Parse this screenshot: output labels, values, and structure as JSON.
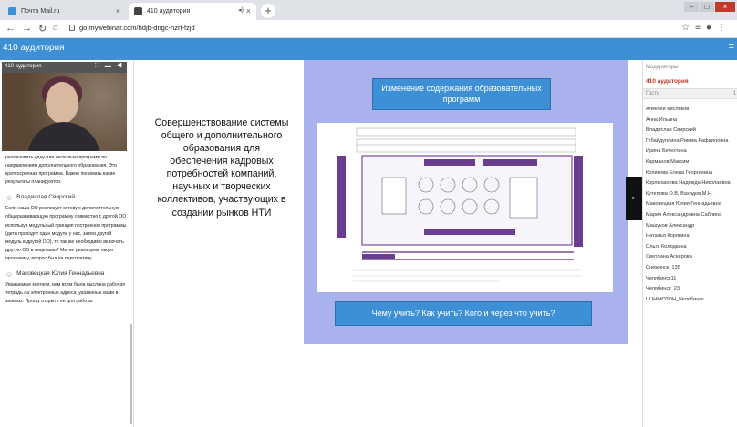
{
  "browser": {
    "tabs": [
      {
        "label": "Почта Mail.ru",
        "close": "×"
      },
      {
        "label": "410 аудитория",
        "close": "×"
      }
    ],
    "new_tab": "+",
    "url": "go.mywebinar.com/hdjb-dngc-hzrt-fzjd",
    "colors": {
      "tab_bar": "#dfe3e8",
      "close_button": "#c0392b"
    }
  },
  "app": {
    "title": "410 аудитория",
    "accent": "#3d8fd6"
  },
  "video": {
    "title": "410 аудитория"
  },
  "chat": {
    "messages": [
      {
        "author": "",
        "text": "реализовать одну или несколько программ по направлениям дополнительного образования. Это краткосрочная программа. Важно понимать какие результаты планируются."
      },
      {
        "author": "Владислав Свирский",
        "text": "Если наша ОО реализует сетевую дополнительную общеразвивающую программу совместно с другой ОО используя модульный принцип построения программы (дети проходят один модуль у нас, затем другой модуль в другой ОО), то так же необходимо включать другую ОО в лицензию? Мы не реализуем такую программу, вопрос был на перспективу."
      },
      {
        "author": "Маковецкая Юлия Геннадьевна",
        "text": "Уважаемые коллеги, вам всем была выслана рабочая тетрадь на электронные адреса, указанные вами в заявках. Прошу открыть ее для работы."
      }
    ]
  },
  "slide": {
    "left_text": "Совершенствование системы общего и дополнительного образования для обеспечения кадровых потребностей компаний, научных и творческих коллективов, участвующих в создании рынков НТИ",
    "header": "Изменение содержания образовательных программ",
    "footer": "Чему учить? Как учить? Кого и через что учить?",
    "background_color": "#a9b2ec"
  },
  "sidebar": {
    "moderators_label": "Модераторы",
    "moderator": "410 аудитория",
    "guests_label": "Гости",
    "guests_count": "1",
    "guests": [
      "Алексей Кисляков",
      "Анна Ильина",
      "Владислав Свирский",
      "Губайдуллина Римма Рафаиловна",
      "Ирина Бетехтина",
      "Карманов Максим",
      "Коликова Елена Георгиевна",
      "Корлыханова Надежда Николаевна",
      "Кутепова О.В, Вахидов М.Н.",
      "Маковецкая Юлия Геннадьевна",
      "Мария Александровна Саблина",
      "Машуков Александр",
      "Наталья Корякина",
      "Ольга Колодкина",
      "Светлана Аскерова",
      "Снежинск_135",
      "Челябинск11",
      "Челябинск_23",
      "ЦЦНЬЮТОН_Челябинск"
    ]
  }
}
